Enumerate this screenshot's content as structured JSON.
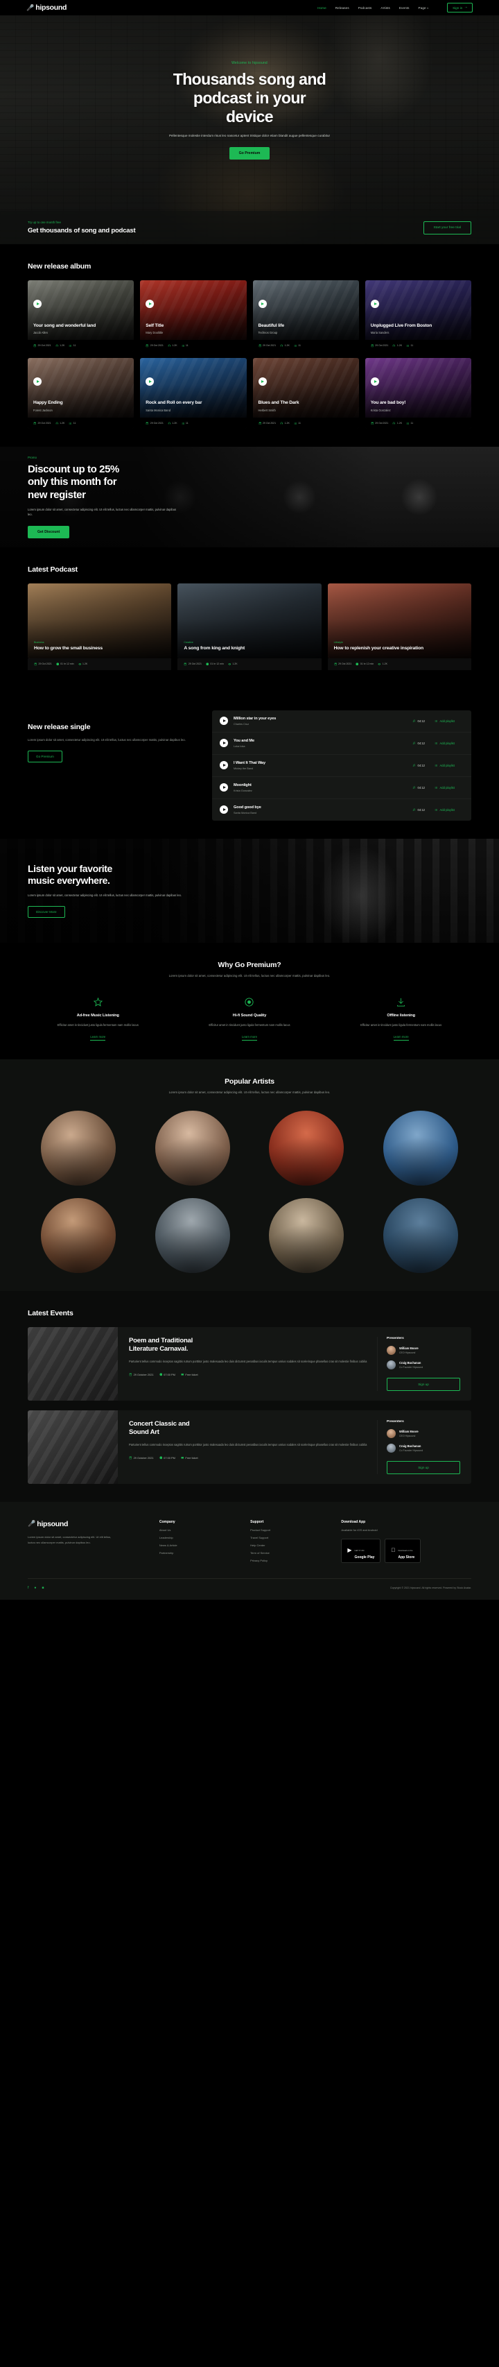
{
  "nav": {
    "brand": "hipsound",
    "brand_icon": "microphone-icon",
    "links": [
      {
        "label": "Home",
        "active": true
      },
      {
        "label": "Releases",
        "active": false
      },
      {
        "label": "Podcasts",
        "active": false
      },
      {
        "label": "Artists",
        "active": false
      },
      {
        "label": "Events",
        "active": false
      },
      {
        "label": "Page",
        "active": false,
        "caret": "∨"
      }
    ],
    "signin": "Sign in",
    "signin_icon": "login-icon"
  },
  "hero": {
    "eyebrow": "Welcome to hipsound",
    "title_line1": "Thousands song and",
    "title_line2": "podcast in your",
    "title_line3": "device",
    "desc": "Pellentesque molestie interdum risus leo nascetur aptent tristique dolor etiam blandit augue pellentesque curabitur",
    "button": "Go Premium",
    "cta_eyebrow": "Try up to one month free",
    "cta_title": "Get thousands of song and podcast",
    "cta_button": "Start your free trial"
  },
  "albums": {
    "title": "New release album",
    "items": [
      {
        "name": "Your song and wonderful land",
        "artist": "Jacob Allen",
        "date": "29 Oct 2021",
        "plays": "1.2K",
        "tracks": "11"
      },
      {
        "name": "Self Title",
        "artist": "Mary Doolittle",
        "date": "29 Oct 2021",
        "plays": "1.2K",
        "tracks": "11"
      },
      {
        "name": "Beautiful life",
        "artist": "Technos Group",
        "date": "29 Oct 2021",
        "plays": "1.2K",
        "tracks": "11"
      },
      {
        "name": "Unplugged Live From Boston",
        "artist": "Maria Sanders",
        "date": "29 Oct 2021",
        "plays": "1.2K",
        "tracks": "11"
      },
      {
        "name": "Happy Ending",
        "artist": "Forest Jackson",
        "date": "29 Oct 2021",
        "plays": "1.2K",
        "tracks": "11"
      },
      {
        "name": "Rock and Roll on every bar",
        "artist": "Santa Monica Band",
        "date": "29 Oct 2021",
        "plays": "1.2K",
        "tracks": "11"
      },
      {
        "name": "Blues and The Dark",
        "artist": "Herbert Smith",
        "date": "29 Oct 2021",
        "plays": "1.2K",
        "tracks": "11"
      },
      {
        "name": "You are bad boy!",
        "artist": "Krista Gonzalez",
        "date": "29 Oct 2021",
        "plays": "1.2K",
        "tracks": "11"
      }
    ]
  },
  "promo": {
    "eyebrow": "Promo",
    "title_line1": "Discount up to 25%",
    "title_line2": "only this month for",
    "title_line3": "new register",
    "desc": "Lorem ipsum dolor sit amet, consectetur adipiscing elit. Ut elit tellus, luctus nec ullamcorper mattis, pulvinar dapibus leo.",
    "button": "Get Discount"
  },
  "podcasts": {
    "title": "Latest Podcast",
    "items": [
      {
        "badge": "Business",
        "title": "How to grow the small business",
        "date": "29 Oct 2021",
        "duration": "01 hr 12 min",
        "views": "1.2K"
      },
      {
        "badge": "Creative",
        "title": "A song from king and knight",
        "date": "29 Oct 2021",
        "duration": "01 hr 12 min",
        "views": "1.2K"
      },
      {
        "badge": "Lifestyle",
        "title": "How to replenish your creative inspiration",
        "date": "29 Oct 2021",
        "duration": "01 hr 12 min",
        "views": "1.2K"
      }
    ]
  },
  "single": {
    "title": "New release single",
    "desc": "Lorem ipsum dolor sit amet, consectetur adipiscing elit. Ut elit tellus, luctus nec ullamcorper mattis, pulvinar dapibus leo.",
    "button": "Go Premium",
    "add_label": "Add playlist",
    "tracks": [
      {
        "name": "Million star in your eyes",
        "artist": "Charles Cruz",
        "duration": "04:12"
      },
      {
        "name": "You and Me",
        "artist": "Loka Ioka",
        "duration": "04:12"
      },
      {
        "name": "I Want It That Way",
        "artist": "Mickey the Band",
        "duration": "04:12"
      },
      {
        "name": "Moonlight",
        "artist": "Krista Gonzalez",
        "duration": "04:12"
      },
      {
        "name": "Good good bye",
        "artist": "Santa Monica Band",
        "duration": "04:12"
      }
    ]
  },
  "listen": {
    "title_line1": "Listen your favorite",
    "title_line2": "music everywhere.",
    "desc": "Lorem ipsum dolor sit amet, consectetur adipiscing elit. Ut elit tellus, luctus nec ullamcorper mattis, pulvinar dapibus leo.",
    "button": "Discover More"
  },
  "premium": {
    "title": "Why Go Premium?",
    "subtitle": "Lorem ipsum dolor sit amet, consectetur adipiscing elit. Ut elit tellus, luctus nec ullamcorper mattis, pulvinar dapibus leo.",
    "features": [
      {
        "icon": "star-icon",
        "title": "Ad-free Music Listening",
        "desc": "Efficitur amet in tincidunt justo ligula fermentum nam mollis lacus",
        "link": "Learn more"
      },
      {
        "icon": "disc-icon",
        "title": "Hi-fi Sound Quality",
        "desc": "Efficitur amet in tincidunt justo ligula fermentum nam mollis lacus",
        "link": "Learn more"
      },
      {
        "icon": "download-icon",
        "title": "Offline listening",
        "desc": "Efficitur amet in tincidunt justo ligula fermentum nam mollis lacus",
        "link": "Learn more"
      }
    ]
  },
  "artists": {
    "title": "Popular Artists",
    "subtitle": "Lorem ipsum dolor sit amet, consectetur adipiscing elit. Ut elit tellus, luctus nec ullamcorper mattis, pulvinar dapibus leo."
  },
  "events": {
    "title": "Latest Events",
    "presenters_label": "Presenters",
    "signup_label": "Sign up",
    "items": [
      {
        "title_line1": "Poem and Traditional",
        "title_line2": "Literature Carnaval.",
        "desc": "Parturient tellus commodo inceptos sagittis rutrum porttitor justo malesuada leo duis dictumst penatibus iaculis tempus varius sodales sit scelerisque phasellus cras sit molestie finibus cubilia",
        "date": "29 October 2021",
        "time": "07:00 PM",
        "ticket": "Free ticket",
        "presenters": [
          {
            "name": "William Moore",
            "role": "CEO Hipsound"
          },
          {
            "name": "Craig Buchanan",
            "role": "Co Founder Hipsound"
          }
        ]
      },
      {
        "title_line1": "Concert Classic and",
        "title_line2": "Sound Art",
        "desc": "Parturient tellus commodo inceptos sagittis rutrum porttitor justo malesuada leo duis dictumst penatibus iaculis tempus varius sodales sit scelerisque phasellus cras sit molestie finibus cubilia",
        "date": "29 October 2021",
        "time": "07:00 PM",
        "ticket": "Free ticket",
        "presenters": [
          {
            "name": "William Moore",
            "role": "CEO Hipsound"
          },
          {
            "name": "Craig Buchanan",
            "role": "Co Founder Hipsound"
          }
        ]
      }
    ]
  },
  "footer": {
    "brand": "hipsound",
    "about": "Lorem ipsum dolor sit amet, consectetur adipiscing elit. Ut elit tellus, luctus nec ullamcorper mattis, pulvinar dapibus leo.",
    "company_title": "Company",
    "company_links": [
      "About Us",
      "Leadership",
      "News & Article",
      "Partnership"
    ],
    "support_title": "Support",
    "support_links": [
      "Product Support",
      "Travel Support",
      "Help Center",
      "Term of Service",
      "Privacy Policy"
    ],
    "download_title": "Download App",
    "download_sub": "Available for iOS and Android",
    "store_google_small": "GET IT ON",
    "store_google_large": "Google Play",
    "store_apple_small": "Download on the",
    "store_apple_large": "App Store",
    "socials": [
      "facebook-icon",
      "twitter-icon",
      "instagram-icon"
    ],
    "copyright": "Copyright © 2021 hipsound. All rights reserved. Powered by Stock Avatar."
  }
}
